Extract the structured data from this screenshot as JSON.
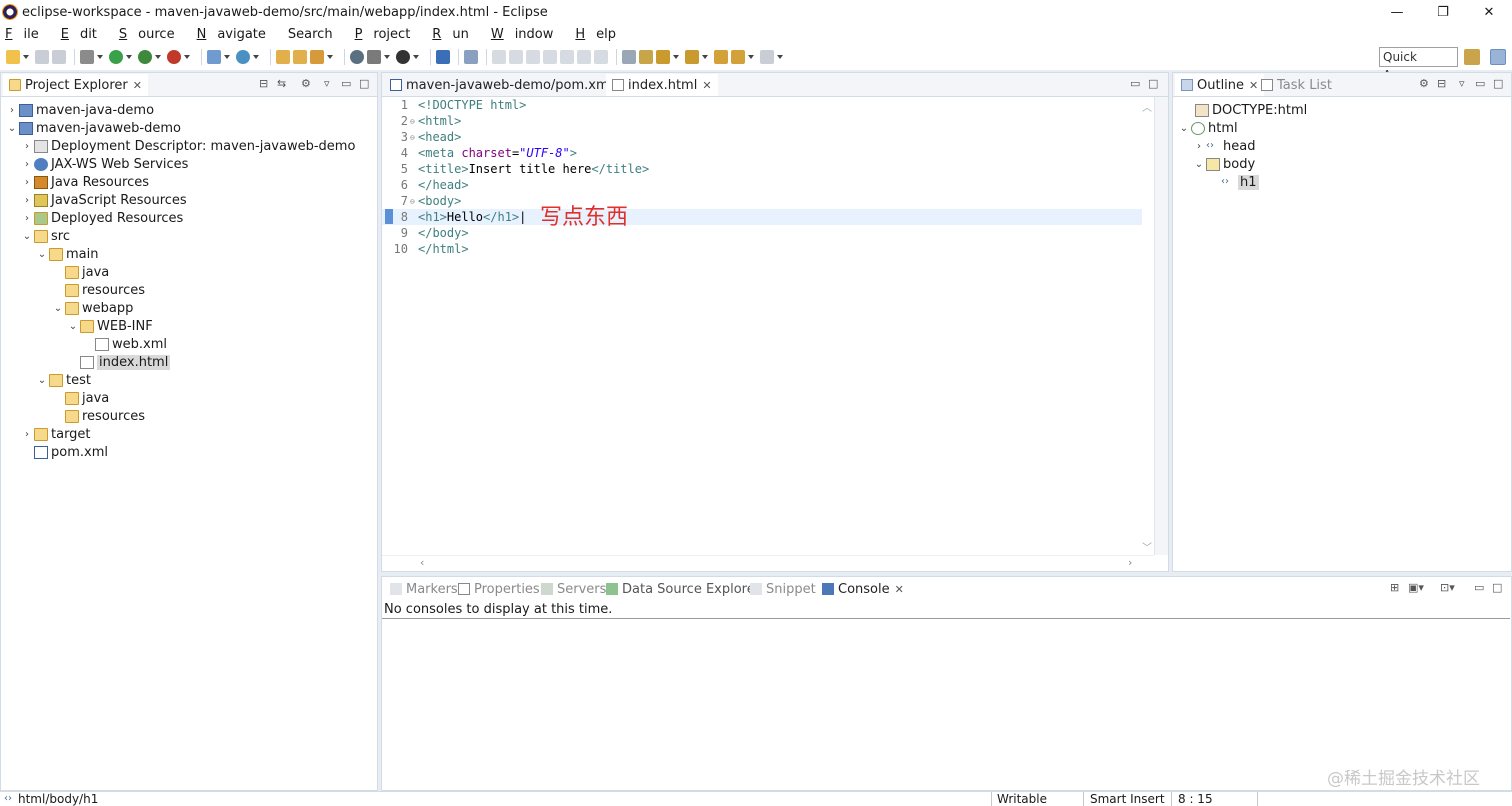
{
  "window": {
    "title": "eclipse-workspace - maven-javaweb-demo/src/main/webapp/index.html - Eclipse",
    "controls": [
      "—",
      "❐",
      "✕"
    ]
  },
  "menu": [
    {
      "label": "File",
      "mnemonic": "F",
      "rest": "ile"
    },
    {
      "label": "Edit",
      "mnemonic": "E",
      "rest": "dit"
    },
    {
      "label": "Source",
      "mnemonic": "S",
      "rest": "ource"
    },
    {
      "label": "Navigate",
      "mnemonic": "N",
      "rest": "avigate"
    },
    {
      "label": "Search",
      "mnemonic": "",
      "rest": "Search"
    },
    {
      "label": "Project",
      "mnemonic": "P",
      "rest": "roject"
    },
    {
      "label": "Run",
      "mnemonic": "R",
      "rest": "un"
    },
    {
      "label": "Window",
      "mnemonic": "W",
      "rest": "indow"
    },
    {
      "label": "Help",
      "mnemonic": "H",
      "rest": "elp"
    }
  ],
  "toolbar": {
    "quick_access": "Quick Access"
  },
  "project_explorer": {
    "title": "Project Explorer",
    "items": [
      {
        "label": "maven-java-demo",
        "twisty": "›",
        "icon": "project-icon"
      },
      {
        "label": "maven-javaweb-demo",
        "twisty": "⌄",
        "icon": "project-icon"
      },
      {
        "label": "Deployment Descriptor: maven-javaweb-demo",
        "twisty": "›",
        "icon": "deployment-descriptor-icon"
      },
      {
        "label": "JAX-WS Web Services",
        "twisty": "›",
        "icon": "web-services-icon"
      },
      {
        "label": "Java Resources",
        "twisty": "›",
        "icon": "java-resources-icon"
      },
      {
        "label": "JavaScript Resources",
        "twisty": "›",
        "icon": "javascript-resources-icon"
      },
      {
        "label": "Deployed Resources",
        "twisty": "›",
        "icon": "deployed-resources-icon"
      },
      {
        "label": "src",
        "twisty": "⌄",
        "icon": "folder-icon"
      },
      {
        "label": "main",
        "twisty": "⌄",
        "icon": "folder-icon"
      },
      {
        "label": "java",
        "twisty": "",
        "icon": "folder-icon"
      },
      {
        "label": "resources",
        "twisty": "",
        "icon": "folder-icon"
      },
      {
        "label": "webapp",
        "twisty": "⌄",
        "icon": "folder-icon"
      },
      {
        "label": "WEB-INF",
        "twisty": "⌄",
        "icon": "folder-icon"
      },
      {
        "label": "web.xml",
        "twisty": "",
        "icon": "xml-file-icon"
      },
      {
        "label": "index.html",
        "twisty": "",
        "icon": "html-file-icon"
      },
      {
        "label": "test",
        "twisty": "⌄",
        "icon": "folder-icon"
      },
      {
        "label": "java",
        "twisty": "",
        "icon": "folder-icon"
      },
      {
        "label": "resources",
        "twisty": "",
        "icon": "folder-icon"
      },
      {
        "label": "target",
        "twisty": "›",
        "icon": "folder-icon"
      },
      {
        "label": "pom.xml",
        "twisty": "",
        "icon": "maven-file-icon"
      }
    ]
  },
  "editor": {
    "tabs": [
      {
        "label": "maven-javaweb-demo/pom.xml"
      },
      {
        "label": "index.html"
      }
    ],
    "lines": [
      {
        "num": "1",
        "fold": ""
      },
      {
        "num": "2",
        "fold": "⊖"
      },
      {
        "num": "3",
        "fold": "⊖"
      },
      {
        "num": "4",
        "fold": ""
      },
      {
        "num": "5",
        "fold": ""
      },
      {
        "num": "6",
        "fold": ""
      },
      {
        "num": "7",
        "fold": "⊖"
      },
      {
        "num": "8",
        "fold": ""
      },
      {
        "num": "9",
        "fold": ""
      },
      {
        "num": "10",
        "fold": ""
      }
    ],
    "code": {
      "l1": "<!DOCTYPE html>",
      "l2": "<html>",
      "l3": "<head>",
      "l4_tag_open": "<meta ",
      "l4_attr": "charset",
      "l4_eq": "=",
      "l4_val": "\"UTF-8\"",
      "l4_close": ">",
      "l5_open": "<title>",
      "l5_text": "Insert title here",
      "l5_close": "</title>",
      "l6": "</head>",
      "l7": "<body>",
      "l8_open": "<h1>",
      "l8_text": "Hello",
      "l8_close": "</h1>",
      "l9": "</body>",
      "l10": "</html>"
    },
    "annotation": "写点东西"
  },
  "outline": {
    "tabs": [
      {
        "label": "Outline"
      },
      {
        "label": "Task List"
      }
    ],
    "items": [
      {
        "label": "DOCTYPE:html",
        "twisty": ""
      },
      {
        "label": "html",
        "twisty": "⌄"
      },
      {
        "label": "head",
        "twisty": "›"
      },
      {
        "label": "body",
        "twisty": "⌄"
      },
      {
        "label": "h1",
        "twisty": ""
      }
    ]
  },
  "bottom": {
    "tabs": [
      {
        "label": "Markers"
      },
      {
        "label": "Properties"
      },
      {
        "label": "Servers"
      },
      {
        "label": "Data Source Explorer"
      },
      {
        "label": "Snippets"
      },
      {
        "label": "Console"
      }
    ],
    "message": "No consoles to display at this time."
  },
  "status": {
    "path": "html/body/h1",
    "writable": "Writable",
    "insert_mode": "Smart Insert",
    "position": "8 : 15"
  },
  "watermark": "@稀土掘金技术社区"
}
